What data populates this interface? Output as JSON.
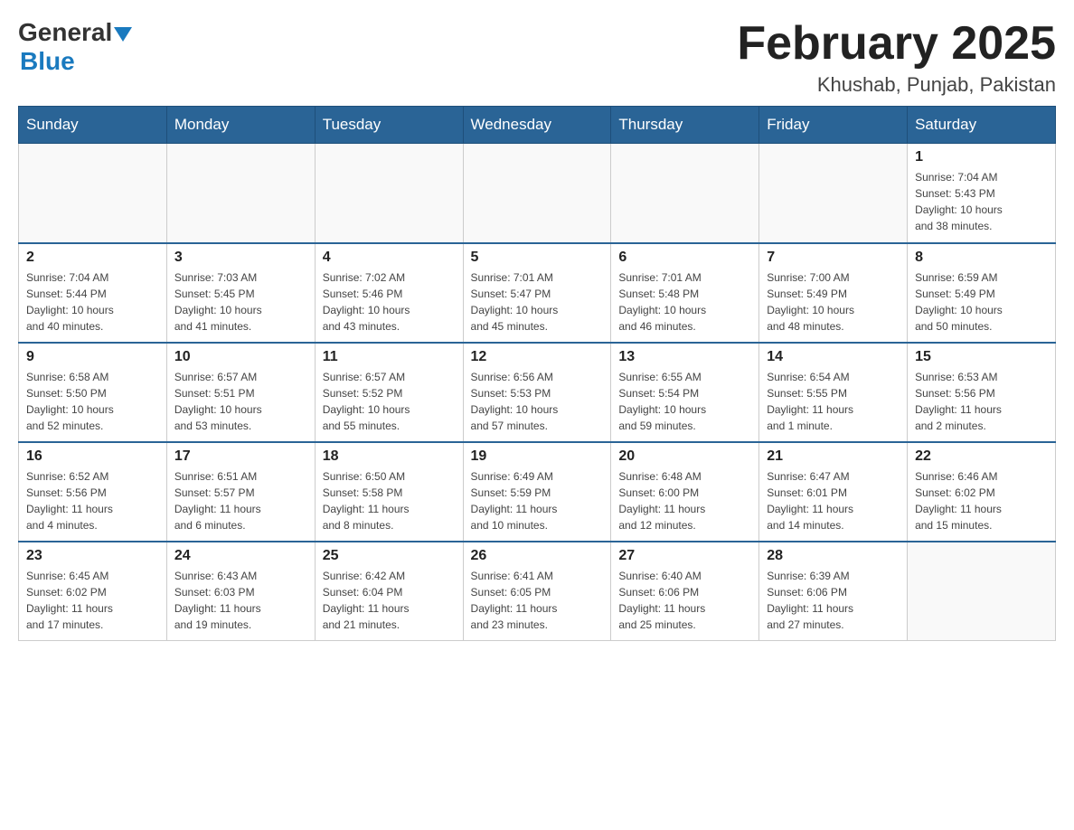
{
  "header": {
    "logo_general": "General",
    "logo_blue": "Blue",
    "month": "February 2025",
    "location": "Khushab, Punjab, Pakistan"
  },
  "weekdays": [
    "Sunday",
    "Monday",
    "Tuesday",
    "Wednesday",
    "Thursday",
    "Friday",
    "Saturday"
  ],
  "weeks": [
    [
      {
        "day": "",
        "info": ""
      },
      {
        "day": "",
        "info": ""
      },
      {
        "day": "",
        "info": ""
      },
      {
        "day": "",
        "info": ""
      },
      {
        "day": "",
        "info": ""
      },
      {
        "day": "",
        "info": ""
      },
      {
        "day": "1",
        "info": "Sunrise: 7:04 AM\nSunset: 5:43 PM\nDaylight: 10 hours\nand 38 minutes."
      }
    ],
    [
      {
        "day": "2",
        "info": "Sunrise: 7:04 AM\nSunset: 5:44 PM\nDaylight: 10 hours\nand 40 minutes."
      },
      {
        "day": "3",
        "info": "Sunrise: 7:03 AM\nSunset: 5:45 PM\nDaylight: 10 hours\nand 41 minutes."
      },
      {
        "day": "4",
        "info": "Sunrise: 7:02 AM\nSunset: 5:46 PM\nDaylight: 10 hours\nand 43 minutes."
      },
      {
        "day": "5",
        "info": "Sunrise: 7:01 AM\nSunset: 5:47 PM\nDaylight: 10 hours\nand 45 minutes."
      },
      {
        "day": "6",
        "info": "Sunrise: 7:01 AM\nSunset: 5:48 PM\nDaylight: 10 hours\nand 46 minutes."
      },
      {
        "day": "7",
        "info": "Sunrise: 7:00 AM\nSunset: 5:49 PM\nDaylight: 10 hours\nand 48 minutes."
      },
      {
        "day": "8",
        "info": "Sunrise: 6:59 AM\nSunset: 5:49 PM\nDaylight: 10 hours\nand 50 minutes."
      }
    ],
    [
      {
        "day": "9",
        "info": "Sunrise: 6:58 AM\nSunset: 5:50 PM\nDaylight: 10 hours\nand 52 minutes."
      },
      {
        "day": "10",
        "info": "Sunrise: 6:57 AM\nSunset: 5:51 PM\nDaylight: 10 hours\nand 53 minutes."
      },
      {
        "day": "11",
        "info": "Sunrise: 6:57 AM\nSunset: 5:52 PM\nDaylight: 10 hours\nand 55 minutes."
      },
      {
        "day": "12",
        "info": "Sunrise: 6:56 AM\nSunset: 5:53 PM\nDaylight: 10 hours\nand 57 minutes."
      },
      {
        "day": "13",
        "info": "Sunrise: 6:55 AM\nSunset: 5:54 PM\nDaylight: 10 hours\nand 59 minutes."
      },
      {
        "day": "14",
        "info": "Sunrise: 6:54 AM\nSunset: 5:55 PM\nDaylight: 11 hours\nand 1 minute."
      },
      {
        "day": "15",
        "info": "Sunrise: 6:53 AM\nSunset: 5:56 PM\nDaylight: 11 hours\nand 2 minutes."
      }
    ],
    [
      {
        "day": "16",
        "info": "Sunrise: 6:52 AM\nSunset: 5:56 PM\nDaylight: 11 hours\nand 4 minutes."
      },
      {
        "day": "17",
        "info": "Sunrise: 6:51 AM\nSunset: 5:57 PM\nDaylight: 11 hours\nand 6 minutes."
      },
      {
        "day": "18",
        "info": "Sunrise: 6:50 AM\nSunset: 5:58 PM\nDaylight: 11 hours\nand 8 minutes."
      },
      {
        "day": "19",
        "info": "Sunrise: 6:49 AM\nSunset: 5:59 PM\nDaylight: 11 hours\nand 10 minutes."
      },
      {
        "day": "20",
        "info": "Sunrise: 6:48 AM\nSunset: 6:00 PM\nDaylight: 11 hours\nand 12 minutes."
      },
      {
        "day": "21",
        "info": "Sunrise: 6:47 AM\nSunset: 6:01 PM\nDaylight: 11 hours\nand 14 minutes."
      },
      {
        "day": "22",
        "info": "Sunrise: 6:46 AM\nSunset: 6:02 PM\nDaylight: 11 hours\nand 15 minutes."
      }
    ],
    [
      {
        "day": "23",
        "info": "Sunrise: 6:45 AM\nSunset: 6:02 PM\nDaylight: 11 hours\nand 17 minutes."
      },
      {
        "day": "24",
        "info": "Sunrise: 6:43 AM\nSunset: 6:03 PM\nDaylight: 11 hours\nand 19 minutes."
      },
      {
        "day": "25",
        "info": "Sunrise: 6:42 AM\nSunset: 6:04 PM\nDaylight: 11 hours\nand 21 minutes."
      },
      {
        "day": "26",
        "info": "Sunrise: 6:41 AM\nSunset: 6:05 PM\nDaylight: 11 hours\nand 23 minutes."
      },
      {
        "day": "27",
        "info": "Sunrise: 6:40 AM\nSunset: 6:06 PM\nDaylight: 11 hours\nand 25 minutes."
      },
      {
        "day": "28",
        "info": "Sunrise: 6:39 AM\nSunset: 6:06 PM\nDaylight: 11 hours\nand 27 minutes."
      },
      {
        "day": "",
        "info": ""
      }
    ]
  ]
}
